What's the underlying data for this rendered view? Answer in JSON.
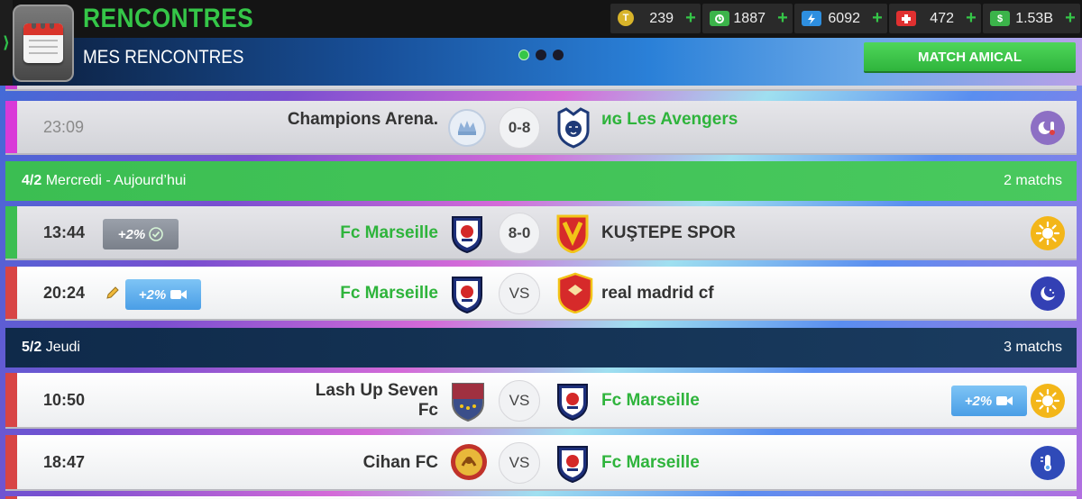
{
  "header": {
    "title": "RENCONTRES",
    "subtitle": "MES RENCONTRES",
    "match_amical": "MATCH AMICAL",
    "pager": {
      "pages": 3,
      "active": 1
    }
  },
  "currencies": [
    {
      "icon": "token-icon",
      "value": "239",
      "color": "#d8b42a"
    },
    {
      "icon": "training-icon",
      "value": "1887",
      "color": "#3bb44a"
    },
    {
      "icon": "energy-icon",
      "value": "6092",
      "color": "#2e8fe0"
    },
    {
      "icon": "medical-icon",
      "value": "472",
      "color": "#e03030"
    },
    {
      "icon": "cash-icon",
      "value": "1.53B",
      "color": "#3bb44a"
    }
  ],
  "matches": [
    {
      "time": "23:09",
      "home": "Champions Arena.",
      "score": "0-8",
      "away": "ᴎɢ Les Avengers",
      "weather": "night-cold-icon"
    },
    {
      "time": "13:44",
      "home": "Fc Marseille",
      "score": "8-0",
      "away": "KUŞTEPE SPOR",
      "boost": "+2%",
      "weather": "sun-icon"
    },
    {
      "time": "20:24",
      "home": "Fc Marseille",
      "score": "VS",
      "away": "real madrid cf",
      "boost": "+2%",
      "weather": "night-icon"
    },
    {
      "time": "10:50",
      "home": "Lash Up Seven Fc",
      "score": "VS",
      "away": "Fc Marseille",
      "boost": "+2%",
      "weather": "sun-icon"
    },
    {
      "time": "18:47",
      "home": "Cihan FC",
      "score": "VS",
      "away": "Fc Marseille",
      "weather": "cold-icon"
    }
  ],
  "days": [
    {
      "date_bold": "4/2",
      "date_rest": " Mercredi - Aujourd’hui",
      "count": "2 matchs"
    },
    {
      "date_bold": "5/2",
      "date_rest": " Jeudi",
      "count": "3 matchs"
    }
  ]
}
